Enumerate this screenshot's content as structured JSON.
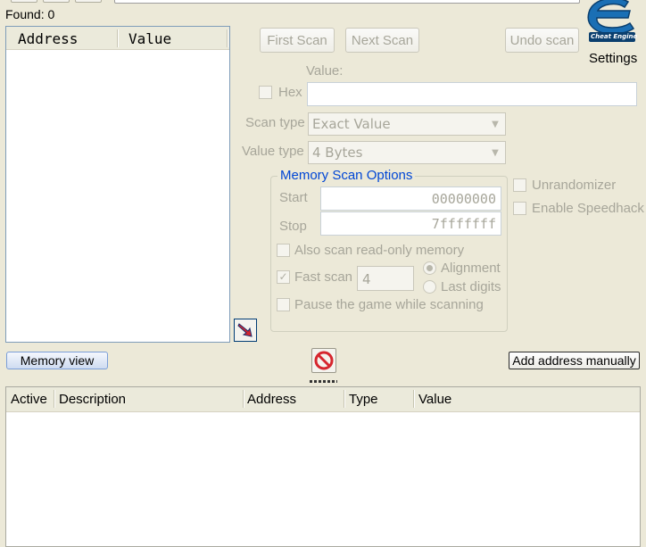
{
  "status": {
    "found": "Found: 0"
  },
  "found_list": {
    "columns": [
      "Address",
      "Value"
    ]
  },
  "scan": {
    "first_scan": "First Scan",
    "next_scan": "Next Scan",
    "undo_scan": "Undo scan",
    "value_label": "Value:",
    "hex_label": "Hex",
    "hex_checked": false,
    "value_input": "",
    "scan_type_label": "Scan type",
    "scan_type_value": "Exact Value",
    "value_type_label": "Value type",
    "value_type_value": "4 Bytes"
  },
  "memory_scan_options": {
    "title": "Memory Scan Options",
    "start_label": "Start",
    "start_value": "00000000",
    "stop_label": "Stop",
    "stop_value": "7fffffff",
    "also_readonly": "Also scan read-only memory",
    "fast_scan": "Fast scan",
    "fast_scan_checked": true,
    "fast_scan_value": "4",
    "alignment": "Alignment",
    "last_digits": "Last digits",
    "alignment_selected": true,
    "pause_game": "Pause the game while scanning"
  },
  "side_options": {
    "unrandomizer": "Unrandomizer",
    "enable_speedhack": "Enable Speedhack",
    "settings": "Settings",
    "logo_text": "Cheat Engine"
  },
  "toolbar": {
    "memory_view": "Memory view",
    "add_address_manually": "Add address manually"
  },
  "address_list": {
    "columns": [
      "Active",
      "Description",
      "Address",
      "Type",
      "Value"
    ]
  },
  "colors": {
    "window_bg": "#ece9d8",
    "accent": "#0046d5",
    "logo_blue": "#1a6fb5",
    "stop_red": "#d6262e"
  }
}
